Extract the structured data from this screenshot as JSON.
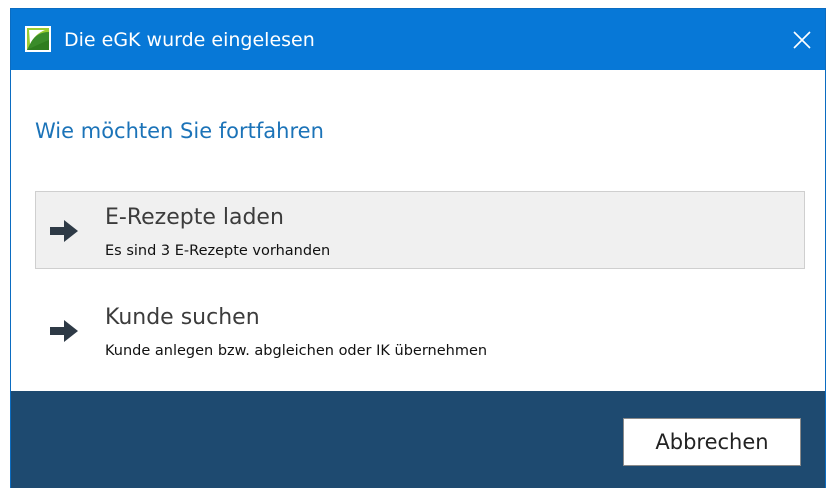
{
  "window": {
    "title": "Die eGK wurde eingelesen"
  },
  "heading": "Wie möchten Sie fortfahren",
  "options": [
    {
      "title": "E-Rezepte laden",
      "subtitle": "Es sind 3 E-Rezepte vorhanden",
      "icon": "arrow-right-icon",
      "highlighted": true
    },
    {
      "title": "Kunde suchen",
      "subtitle": "Kunde anlegen bzw. abgleichen oder IK übernehmen",
      "icon": "arrow-right-icon",
      "highlighted": false
    }
  ],
  "footer": {
    "cancel_label": "Abbrechen"
  },
  "colors": {
    "titlebar": "#0778d7",
    "heading": "#1b73b8",
    "footer": "#1e4a70",
    "highlight_bg": "#f0f0f0"
  }
}
